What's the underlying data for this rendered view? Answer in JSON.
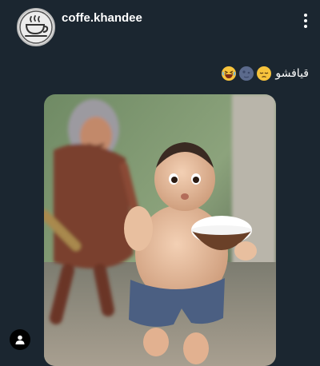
{
  "post": {
    "username": "coffe.khandee",
    "caption_text": "قيافشو",
    "caption_emojis": [
      "grinning-squinting-face",
      "new-moon-face",
      "pensive-face"
    ]
  },
  "icons": {
    "more": "vertical-ellipsis-icon",
    "profile": "person-icon",
    "avatar": "coffee-cup-logo"
  },
  "colors": {
    "background": "#1b2630",
    "text": "#ffffff"
  }
}
